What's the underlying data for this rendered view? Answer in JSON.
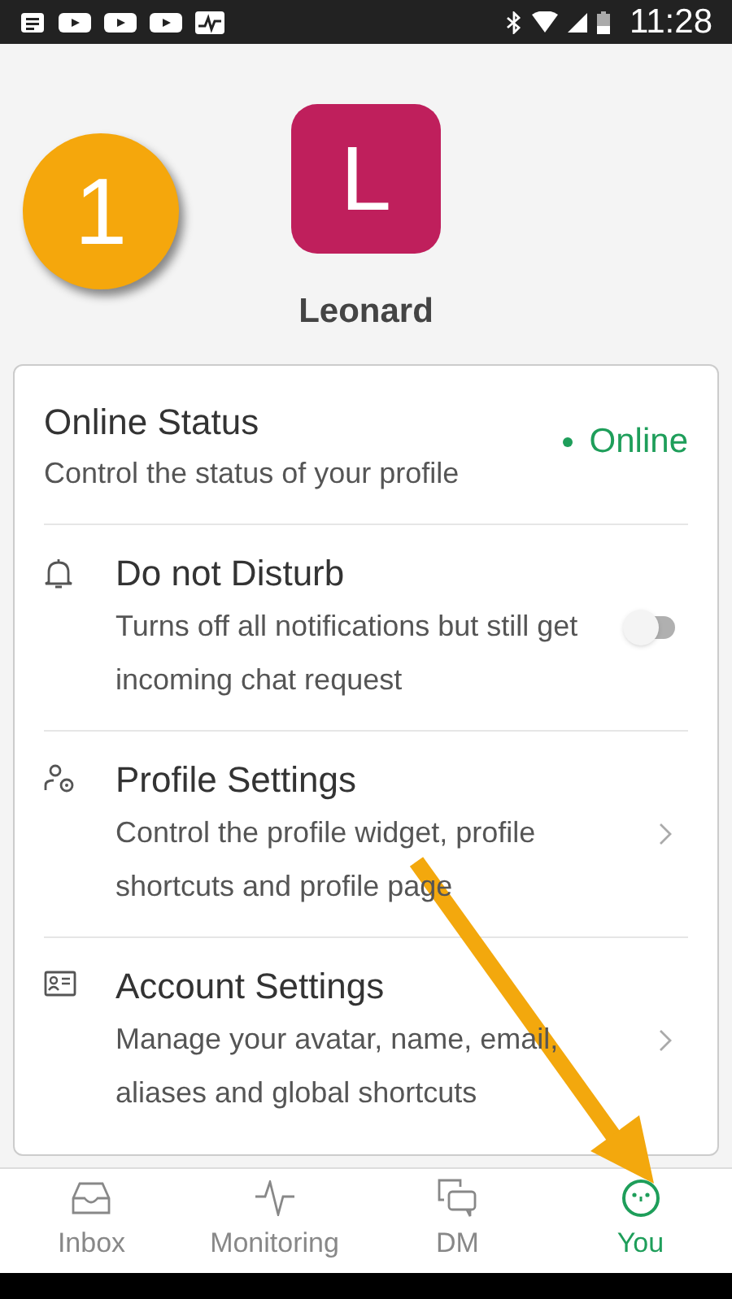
{
  "status_bar": {
    "time": "11:28"
  },
  "profile": {
    "avatar_letter": "L",
    "name": "Leonard"
  },
  "online_status": {
    "title": "Online Status",
    "description": "Control the status of your profile",
    "status": "Online"
  },
  "settings": [
    {
      "kind": "toggle",
      "title": "Do not Disturb",
      "description": "Turns off all notifications but still get incoming chat request",
      "on": false
    },
    {
      "kind": "link",
      "title": "Profile Settings",
      "description": "Control the profile widget, profile shortcuts and profile page"
    },
    {
      "kind": "link",
      "title": "Account Settings",
      "description": "Manage your avatar, name, email, aliases and global shortcuts"
    }
  ],
  "nav": [
    {
      "label": "Inbox",
      "selected": false
    },
    {
      "label": "Monitoring",
      "selected": false
    },
    {
      "label": "DM",
      "selected": false
    },
    {
      "label": "You",
      "selected": true
    }
  ],
  "annotation": {
    "step": "1"
  }
}
